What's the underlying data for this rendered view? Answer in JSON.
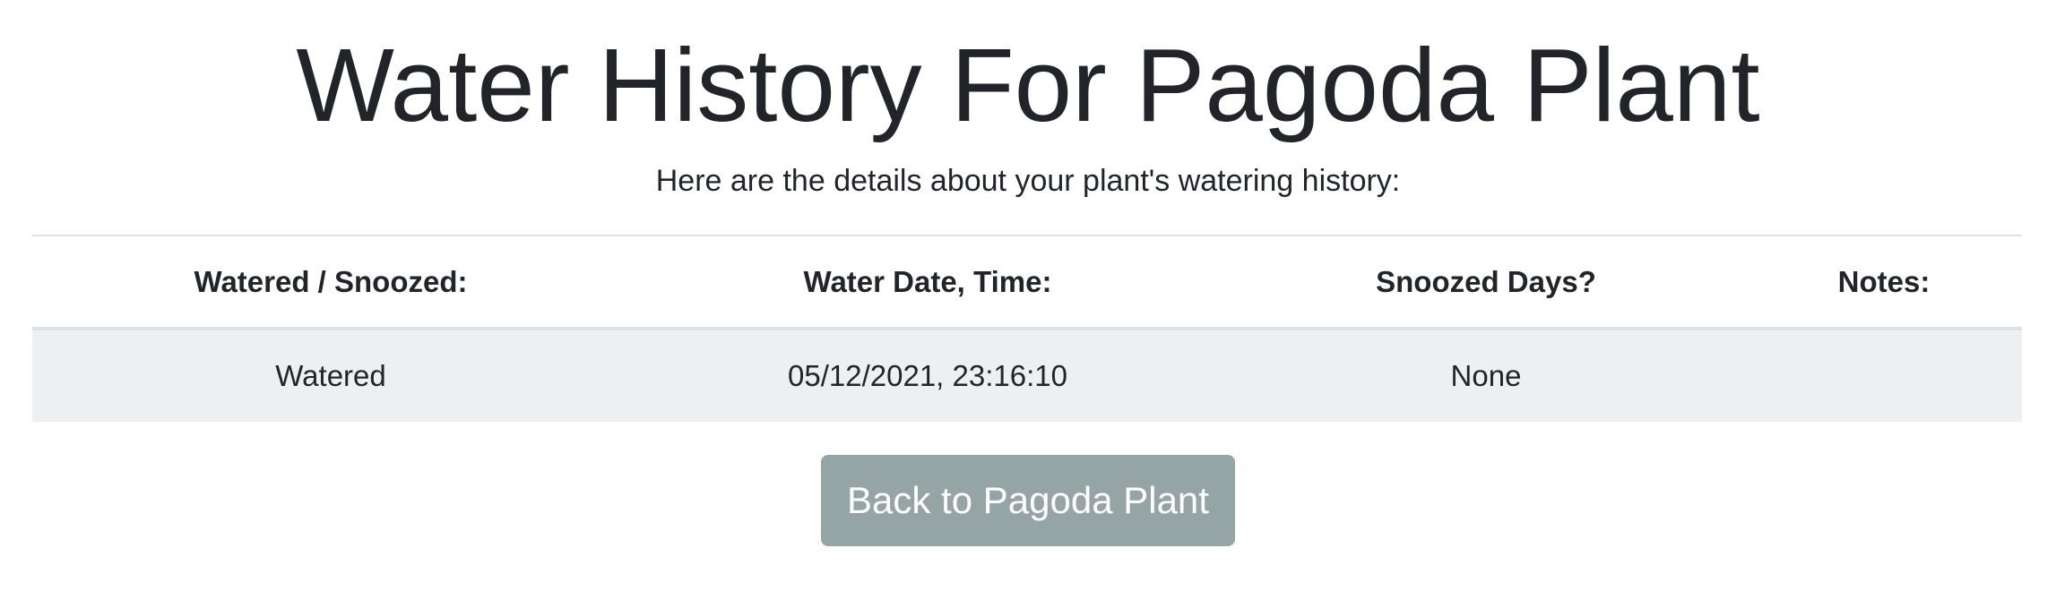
{
  "page": {
    "title": "Water History For Pagoda Plant",
    "subtitle": "Here are the details about your plant's watering history:"
  },
  "table": {
    "headers": [
      "Watered / Snoozed:",
      "Water Date, Time:",
      "Snoozed Days?",
      "Notes:"
    ],
    "rows": [
      [
        "Watered",
        "05/12/2021, 23:16:10",
        "None",
        ""
      ]
    ]
  },
  "actions": {
    "back_label": "Back to Pagoda Plant"
  },
  "colors": {
    "text": "#212529",
    "row_background": "#ecf0f1",
    "button_background": "#95a5a6",
    "button_text": "#ffffff",
    "border": "#dee2e6"
  }
}
